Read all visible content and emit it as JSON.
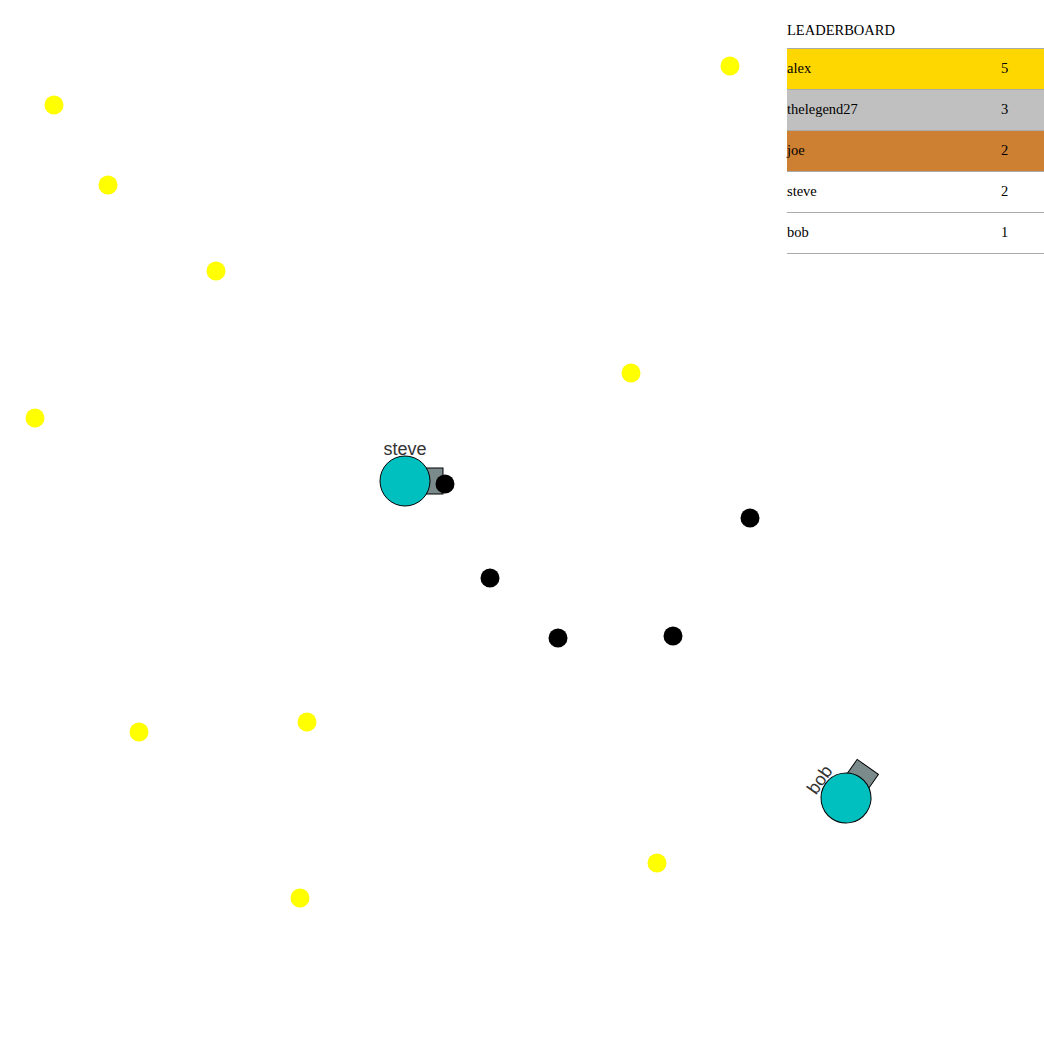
{
  "leaderboard": {
    "title": "LEADERBOARD",
    "rows": [
      {
        "name": "alex",
        "score": "5",
        "color": "#ffd700"
      },
      {
        "name": "thelegend27",
        "score": "3",
        "color": "#c0c0c0"
      },
      {
        "name": "joe",
        "score": "2",
        "color": "#cd7f32"
      },
      {
        "name": "steve",
        "score": "2",
        "color": "#ffffff"
      },
      {
        "name": "bob",
        "score": "1",
        "color": "#ffffff"
      }
    ]
  },
  "players": [
    {
      "name": "steve",
      "aim_deg": 0
    },
    {
      "name": "bob",
      "aim_deg": -55
    }
  ]
}
